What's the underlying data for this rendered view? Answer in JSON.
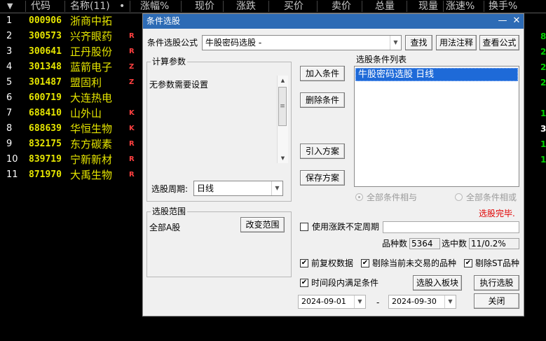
{
  "header": {
    "arrow": "▼",
    "columns": [
      "代码",
      "名称(11)",
      "•",
      "涨幅%",
      "现价",
      "涨跌",
      "买价",
      "卖价",
      "总量",
      "现量",
      "涨速%",
      "换手%"
    ]
  },
  "rows": [
    {
      "num": "1",
      "code": "000906",
      "name": "浙商中拓",
      "tag": "",
      "right": ""
    },
    {
      "num": "2",
      "code": "300573",
      "name": "兴齐眼药",
      "tag": "R",
      "right": "8"
    },
    {
      "num": "3",
      "code": "300641",
      "name": "正丹股份",
      "tag": "R",
      "right": "2"
    },
    {
      "num": "4",
      "code": "301348",
      "name": "蓝箭电子",
      "tag": "Z",
      "right": "2"
    },
    {
      "num": "5",
      "code": "301487",
      "name": "盟固利",
      "tag": "Z",
      "right": "2"
    },
    {
      "num": "6",
      "code": "600719",
      "name": "大连热电",
      "tag": "",
      "right": ""
    },
    {
      "num": "7",
      "code": "688410",
      "name": "山外山",
      "tag": "K",
      "right": "1"
    },
    {
      "num": "8",
      "code": "688639",
      "name": "华恒生物",
      "tag": "K",
      "right": "3"
    },
    {
      "num": "9",
      "code": "832175",
      "name": "东方碳素",
      "tag": "R",
      "right": "1"
    },
    {
      "num": "10",
      "code": "839719",
      "name": "宁新新材",
      "tag": "R",
      "right": "1"
    },
    {
      "num": "11",
      "code": "871970",
      "name": "大禹生物",
      "tag": "R",
      "right": ""
    }
  ],
  "dialog": {
    "title": "条件选股",
    "help_glyph": "—",
    "close_glyph": "✕",
    "formula_label": "条件选股公式",
    "formula_value": "牛股密码选股 -",
    "btn_find": "查找",
    "btn_usage": "用法注释",
    "btn_view": "查看公式",
    "params_title": "计算参数",
    "params_text": "无参数需要设置",
    "period_label": "选股周期:",
    "period_value": "日线",
    "btn_add": "加入条件",
    "btn_delete": "删除条件",
    "btn_import": "引入方案",
    "btn_save": "保存方案",
    "cond_list_title": "选股条件列表",
    "cond_list_items": [
      "牛股密码选股  日线"
    ],
    "radio_and": "全部条件相与",
    "radio_or": "全部条件相或",
    "status": "选股完毕.",
    "scope_title": "选股范围",
    "scope_value": "全部A股",
    "btn_change_scope": "改变范围",
    "chk_uncertain": "使用涨跌不定周期",
    "count_label": "品种数",
    "count_value": "5364",
    "selected_label": "选中数",
    "selected_value": "11/0.2%",
    "chk_fq": "前复权数据",
    "chk_exclude_nontrade": "剔除当前未交易的品种",
    "chk_exclude_st": "剔除ST品种",
    "chk_period_cond": "时间段内满足条件",
    "btn_to_block": "选股入板块",
    "btn_run": "执行选股",
    "date_from": "2024-09-01",
    "date_sep": "-",
    "date_to": "2024-09-30",
    "btn_close": "关闭",
    "check_glyph": "✔"
  },
  "colors": {
    "code": "#e6e600",
    "tag": "#ff4040",
    "right_green": "#00d000",
    "right_white": "#ffffff",
    "title_bar": "#2d6bb5",
    "selection": "#1e6ad8",
    "status": "#e00000"
  }
}
